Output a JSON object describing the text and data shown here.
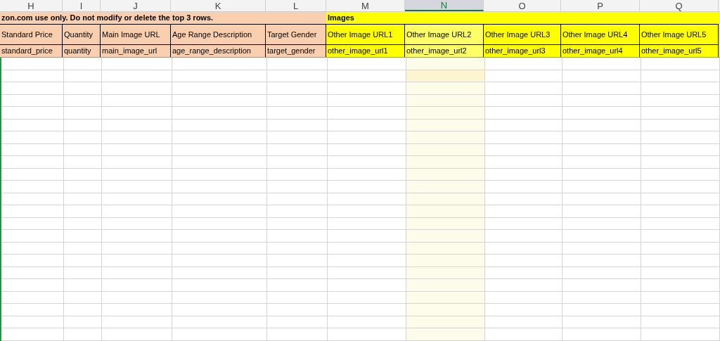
{
  "columns": [
    {
      "letter": "H",
      "selected": false
    },
    {
      "letter": "I",
      "selected": false
    },
    {
      "letter": "J",
      "selected": false
    },
    {
      "letter": "K",
      "selected": false
    },
    {
      "letter": "L",
      "selected": false
    },
    {
      "letter": "M",
      "selected": false
    },
    {
      "letter": "N",
      "selected": true
    },
    {
      "letter": "O",
      "selected": false
    },
    {
      "letter": "P",
      "selected": false
    },
    {
      "letter": "Q",
      "selected": false
    }
  ],
  "banner": [
    {
      "text": "zon.com use only. Do not modify or delete the top 3 rows.",
      "kind": "peach"
    },
    {
      "text": "Images",
      "kind": "yellow"
    }
  ],
  "labels": [
    "Standard Price",
    "Quantity",
    "Main Image URL",
    "Age Range Description",
    "Target Gender",
    "Other Image URL1",
    "Other Image URL2",
    "Other Image URL3",
    "Other Image URL4",
    "Other Image URL5"
  ],
  "field_names": [
    "standard_price",
    "quantity",
    "main_image_url",
    "age_range_description",
    "target_gender",
    "other_image_url1",
    "other_image_url2",
    "other_image_url3",
    "other_image_url4",
    "other_image_url5"
  ],
  "empty_rows": [
    {
      "selected": false
    },
    {
      "selected": true
    },
    {
      "selected": false
    },
    {
      "selected": false
    },
    {
      "selected": false
    },
    {
      "selected": false
    },
    {
      "selected": false
    },
    {
      "selected": false
    },
    {
      "selected": false
    },
    {
      "selected": false
    },
    {
      "selected": false
    },
    {
      "selected": false
    },
    {
      "selected": false
    },
    {
      "selected": false
    },
    {
      "selected": false
    },
    {
      "selected": false
    },
    {
      "selected": false
    },
    {
      "selected": false
    },
    {
      "selected": false
    },
    {
      "selected": false
    },
    {
      "selected": false
    },
    {
      "selected": false
    },
    {
      "selected": false
    }
  ]
}
